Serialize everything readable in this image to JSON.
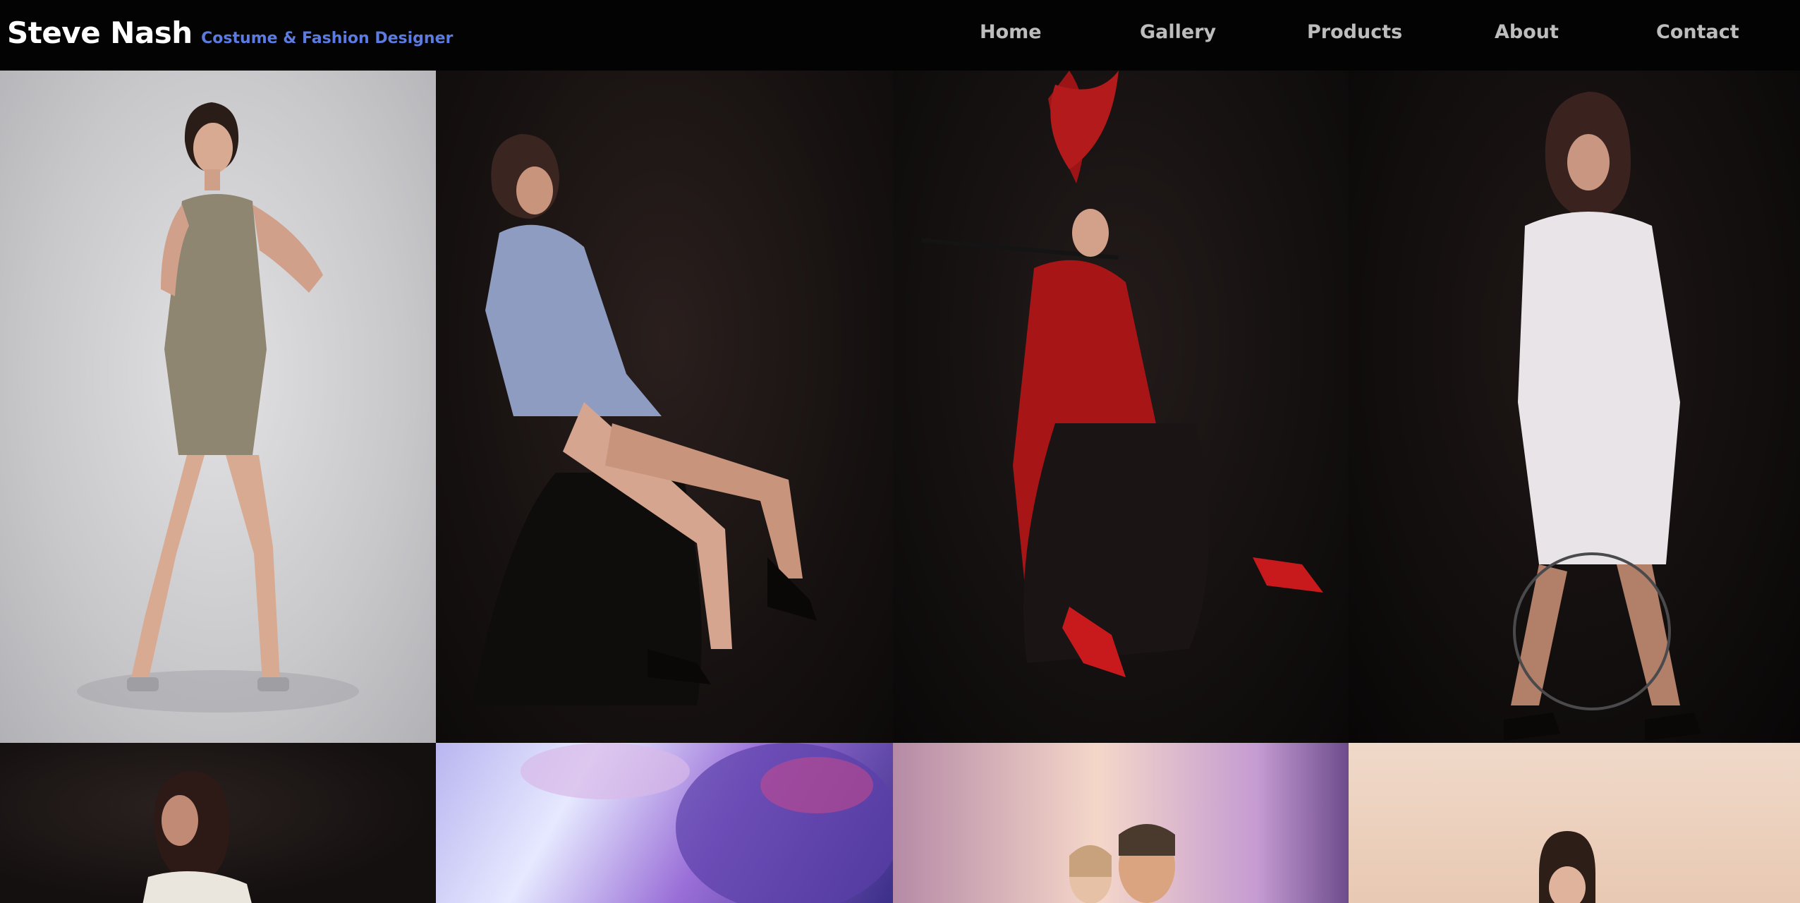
{
  "header": {
    "brand_name": "Steve Nash",
    "brand_tagline": "Costume & Fashion Designer",
    "nav": [
      "Home",
      "Gallery",
      "Products",
      "About",
      "Contact"
    ]
  },
  "colors": {
    "header_bg": "#030303",
    "brand_name": "#ffffff",
    "tagline": "#5b7be0",
    "nav_text": "#bdbdbd"
  },
  "gallery": {
    "photos": [
      "model-in-plaid-dress",
      "model-in-blue-shirt",
      "model-in-red-coat",
      "model-in-white-dress",
      "model-in-white-top",
      "blurred-portrait",
      "couple-on-stage",
      "model-on-beige"
    ]
  }
}
